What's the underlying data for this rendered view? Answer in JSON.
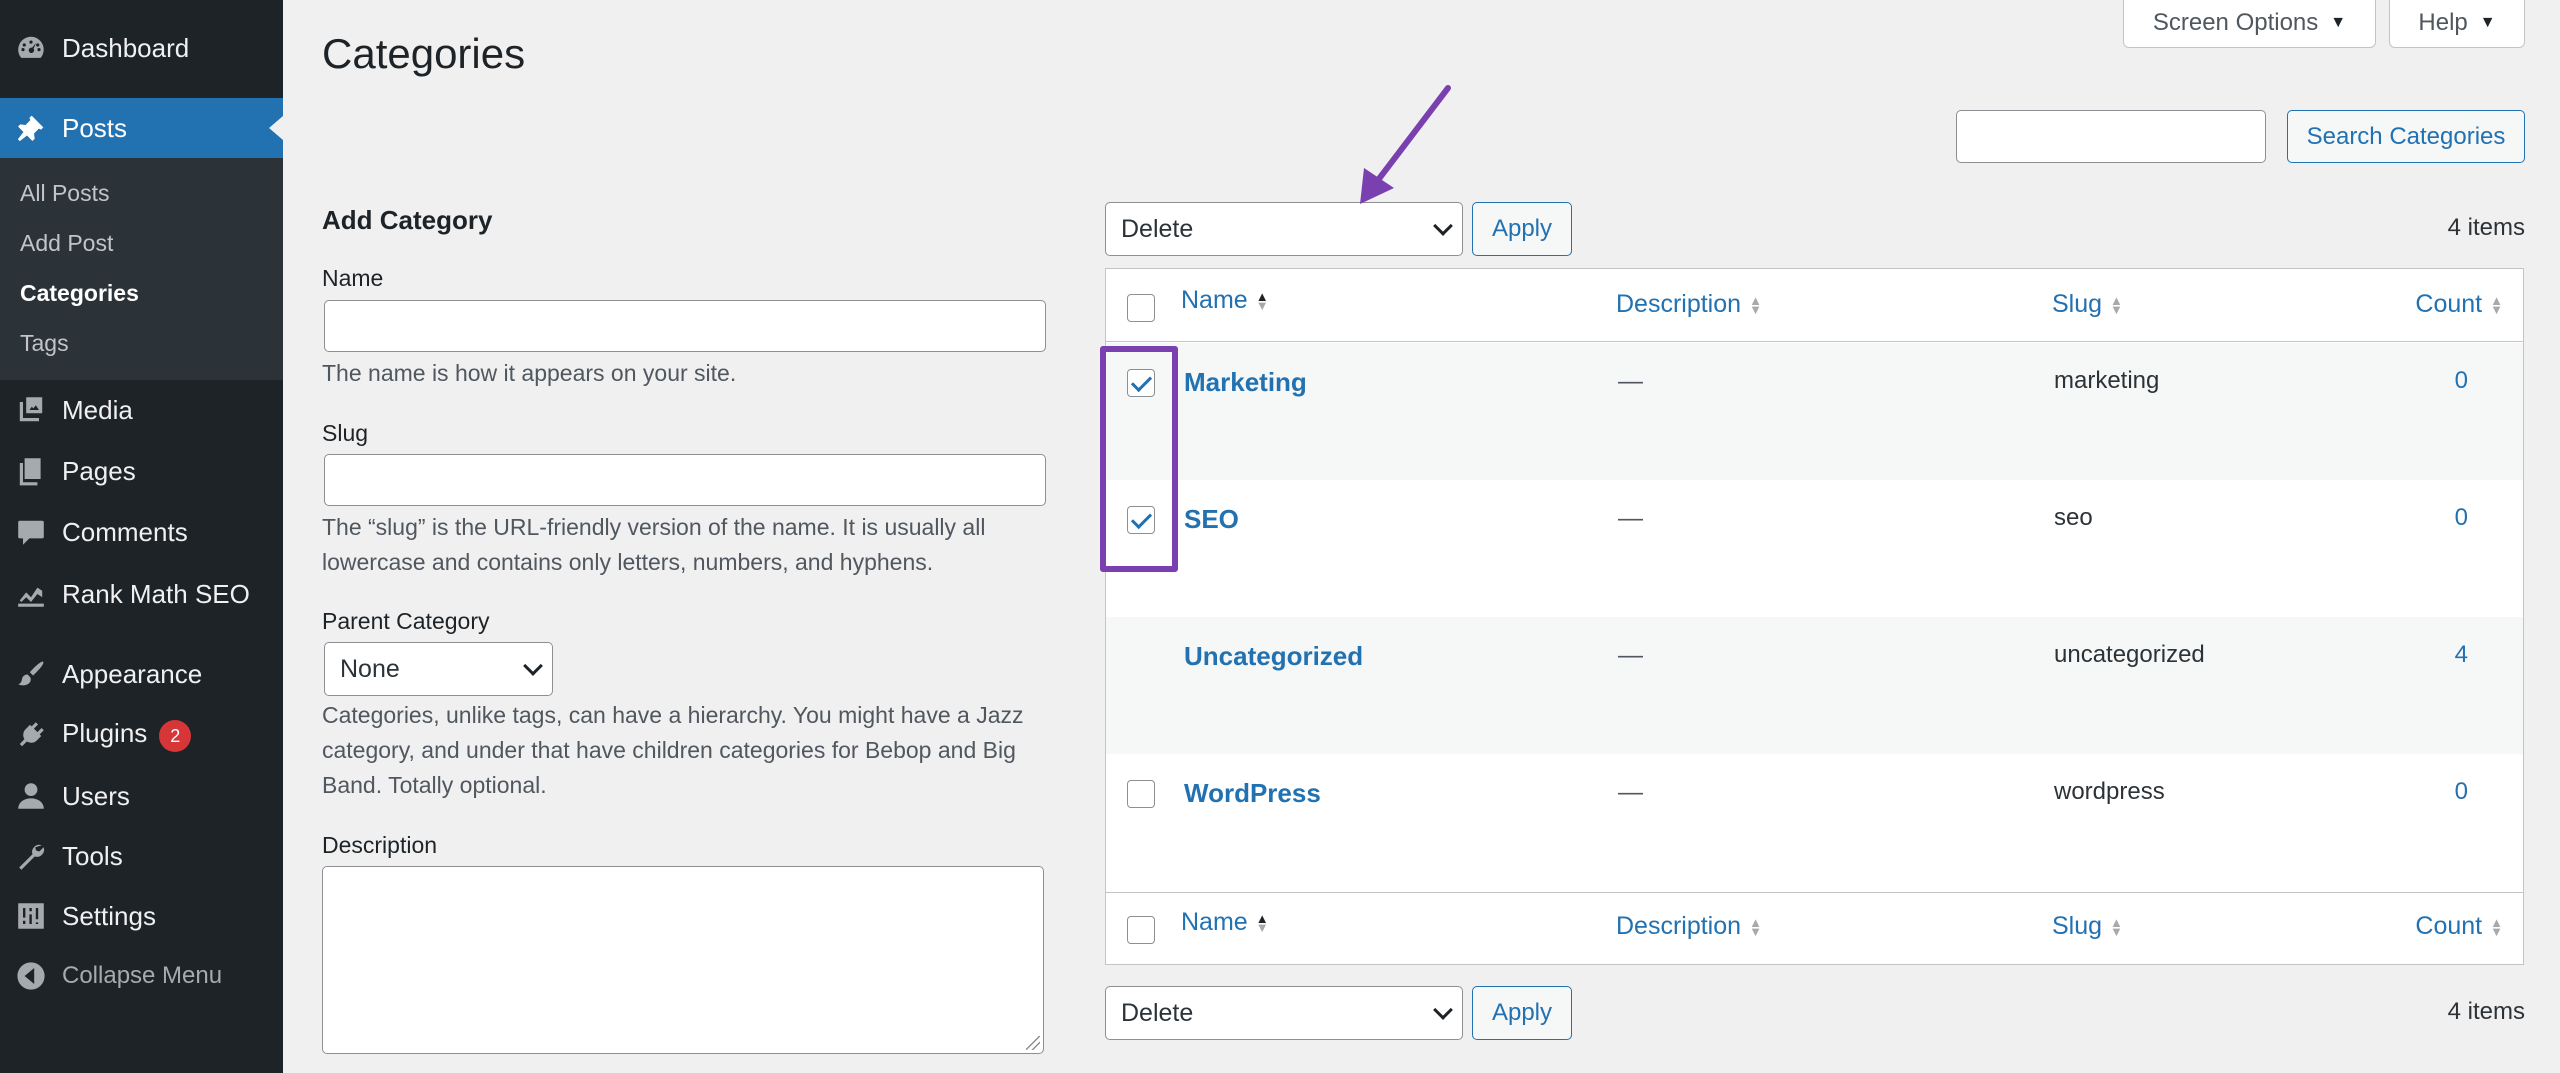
{
  "sidebar": {
    "dashboard": "Dashboard",
    "posts": "Posts",
    "submenu": [
      "All Posts",
      "Add Post",
      "Categories",
      "Tags"
    ],
    "media": "Media",
    "pages": "Pages",
    "comments": "Comments",
    "rank_math": "Rank Math SEO",
    "appearance": "Appearance",
    "plugins": "Plugins",
    "plugins_badge": "2",
    "users": "Users",
    "tools": "Tools",
    "settings": "Settings",
    "collapse": "Collapse Menu"
  },
  "header": {
    "title": "Categories",
    "screen_options": "Screen Options",
    "help": "Help"
  },
  "form": {
    "heading": "Add Category",
    "name_label": "Name",
    "name_help": "The name is how it appears on your site.",
    "slug_label": "Slug",
    "slug_help": "The “slug” is the URL-friendly version of the name. It is usually all lowercase and contains only letters, numbers, and hyphens.",
    "parent_label": "Parent Category",
    "parent_value": "None",
    "parent_help": "Categories, unlike tags, can have a hierarchy. You might have a Jazz category, and under that have children categories for Bebop and Big Band. Totally optional.",
    "description_label": "Description"
  },
  "list": {
    "search_button": "Search Categories",
    "bulk_action": "Delete",
    "apply": "Apply",
    "items_count": "4 items",
    "columns": {
      "name": "Name",
      "description": "Description",
      "slug": "Slug",
      "count": "Count"
    },
    "rows": [
      {
        "name": "Marketing",
        "description": "—",
        "slug": "marketing",
        "count": "0",
        "checked": true
      },
      {
        "name": "SEO",
        "description": "—",
        "slug": "seo",
        "count": "0",
        "checked": true
      },
      {
        "name": "Uncategorized",
        "description": "—",
        "slug": "uncategorized",
        "count": "4",
        "checked": false
      },
      {
        "name": "WordPress",
        "description": "—",
        "slug": "wordpress",
        "count": "0",
        "checked": false
      }
    ]
  },
  "colors": {
    "accent": "#2271b1",
    "sidebar": "#1d2327",
    "annotation": "#7a40b0",
    "badge": "#d63638"
  }
}
